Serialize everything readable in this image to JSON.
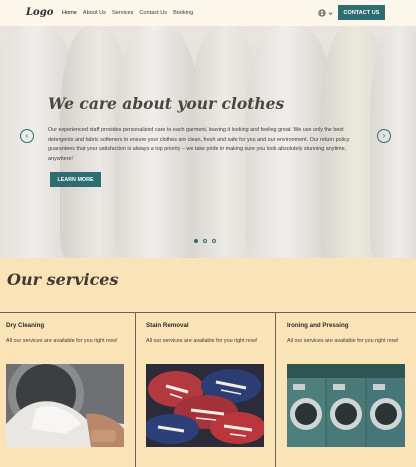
{
  "nav": {
    "logo": "Logo",
    "items": [
      "Home",
      "About Us",
      "Services",
      "Contact Us",
      "Booking"
    ],
    "active_item": "Home",
    "lang_icon": "globe-icon",
    "cta_label": "CONTACT US"
  },
  "hero": {
    "title": "We care about your clothes",
    "text": "Our experienced staff provides personalized care to each garment, leaving it looking and feeling great. We use only the best detergents and fabric softeners to ensure your clothes are clean, fresh and safe for you and our environment. Our return policy guarantees that your satisfaction is always a top priority – we take pride in making sure you look absolutely stunning anytime, anywhere!",
    "button_label": "LEARN MORE",
    "prev_icon": "‹",
    "next_icon": "›",
    "slides": 3,
    "active_slide": 1
  },
  "services": {
    "title": "Our services",
    "cards": [
      {
        "title": "Dry Cleaning",
        "text": "All our services are available for you right now!"
      },
      {
        "title": "Stain Removal",
        "text": "All our services are available for you right now!"
      },
      {
        "title": "Ironing and Pressing",
        "text": "All our services are available for you right now!"
      }
    ]
  },
  "colors": {
    "accent": "#2e6e73",
    "background": "#fbe3b8",
    "nav_bg": "#fdf6ea"
  }
}
